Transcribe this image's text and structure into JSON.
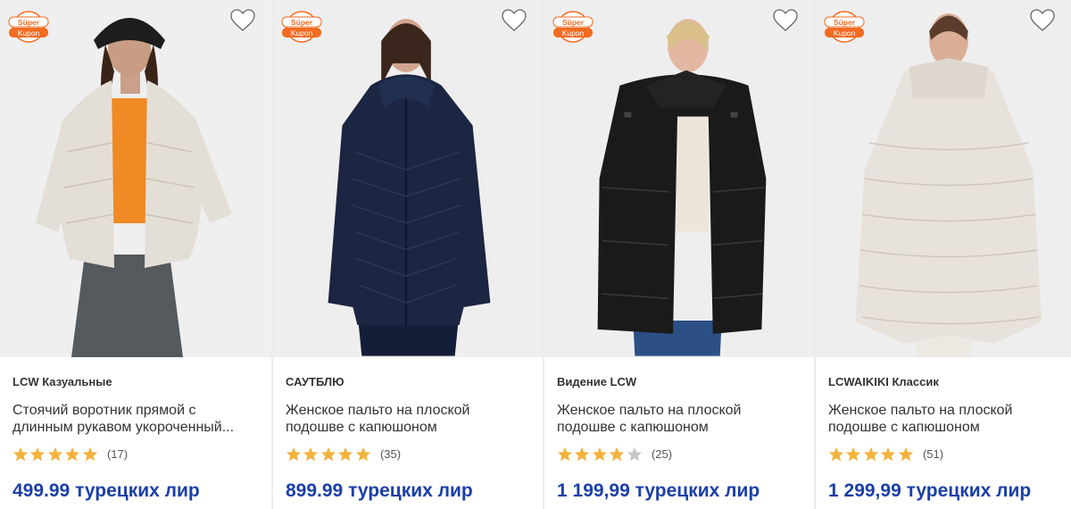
{
  "products": [
    {
      "badge": {
        "line1": "Süper",
        "line2": "Kupon"
      },
      "brand": "LCW Казуальные",
      "title": "Стоячий воротник прямой с длинным рукавом укороченный...",
      "rating": 5,
      "reviews": "(17)",
      "price_amount": "499.99",
      "price_currency": "турецких лир",
      "jacket_color": "#e4dfd6",
      "favorite_icon": "heart-outline-icon"
    },
    {
      "badge": {
        "line1": "Süper",
        "line2": "Kupon"
      },
      "brand": "САУТБЛЮ",
      "title": "Женское пальто на плоской подошве с капюшоном",
      "rating": 5,
      "reviews": "(35)",
      "price_amount": "899.99",
      "price_currency": "турецких лир",
      "jacket_color": "#1c2541",
      "favorite_icon": "heart-outline-icon"
    },
    {
      "badge": {
        "line1": "Süper",
        "line2": "Kupon"
      },
      "brand": "Видение LCW",
      "title": "Женское пальто на плоской подошве с капюшоном",
      "rating": 4,
      "reviews": "(25)",
      "price_amount": "1 199,99",
      "price_currency": "турецких лир",
      "jacket_color": "#1a1a1a",
      "favorite_icon": "heart-outline-icon"
    },
    {
      "badge": {
        "line1": "Süper",
        "line2": "Kupon"
      },
      "brand": "LCWAIKIKI Классик",
      "title": "Женское пальто на плоской подошве с капюшоном",
      "rating": 5,
      "reviews": "(51)",
      "price_amount": "1 299,99",
      "price_currency": "турецких лир",
      "jacket_color": "#e8e2dc",
      "favorite_icon": "heart-outline-icon"
    }
  ],
  "colors": {
    "price": "#1b3fa8",
    "star_filled": "#f2b33d",
    "star_empty": "#c8c8c8",
    "badge_orange": "#f26b21"
  }
}
